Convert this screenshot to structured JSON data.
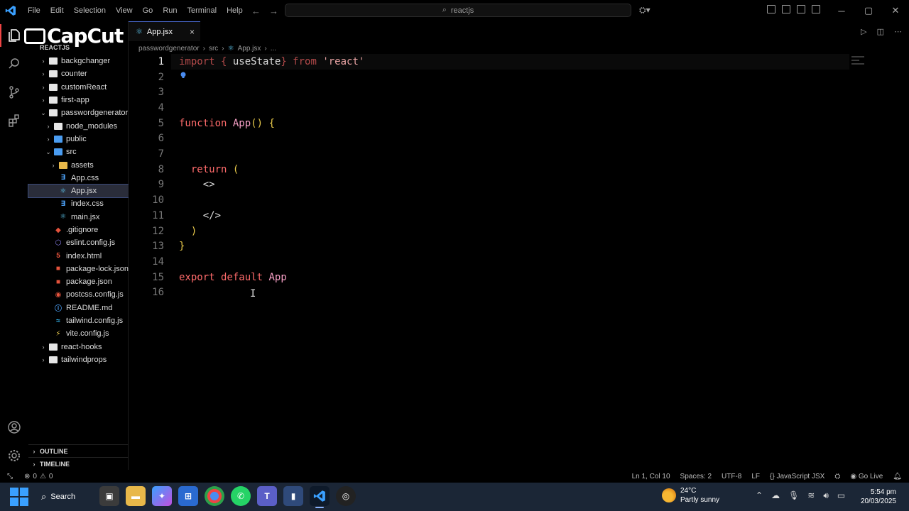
{
  "menu": [
    "File",
    "Edit",
    "Selection",
    "View",
    "Go",
    "Run",
    "Terminal",
    "Help"
  ],
  "command_center": "reactjs",
  "watermark": "CapCut",
  "explorer": {
    "root": "REACTJS",
    "items": [
      {
        "label": "backgchanger",
        "type": "folder",
        "depth": 0,
        "expanded": false
      },
      {
        "label": "counter",
        "type": "folder",
        "depth": 0,
        "expanded": false
      },
      {
        "label": "customReact",
        "type": "folder",
        "depth": 0,
        "expanded": false
      },
      {
        "label": "first-app",
        "type": "folder",
        "depth": 0,
        "expanded": false
      },
      {
        "label": "passwordgenerator",
        "type": "folder",
        "depth": 0,
        "expanded": true
      },
      {
        "label": "node_modules",
        "type": "folder",
        "depth": 1,
        "expanded": false
      },
      {
        "label": "public",
        "type": "folder-blue",
        "depth": 1,
        "expanded": false
      },
      {
        "label": "src",
        "type": "folder-blue",
        "depth": 1,
        "expanded": true
      },
      {
        "label": "assets",
        "type": "folder-yellow",
        "depth": 2,
        "expanded": false
      },
      {
        "label": "App.css",
        "type": "css",
        "depth": 2
      },
      {
        "label": "App.jsx",
        "type": "react",
        "depth": 2,
        "selected": true
      },
      {
        "label": "index.css",
        "type": "css",
        "depth": 2
      },
      {
        "label": "main.jsx",
        "type": "react",
        "depth": 2
      },
      {
        "label": ".gitignore",
        "type": "git",
        "depth": 1
      },
      {
        "label": "eslint.config.js",
        "type": "eslint",
        "depth": 1
      },
      {
        "label": "index.html",
        "type": "html",
        "depth": 1
      },
      {
        "label": "package-lock.json",
        "type": "npm",
        "depth": 1
      },
      {
        "label": "package.json",
        "type": "npm",
        "depth": 1
      },
      {
        "label": "postcss.config.js",
        "type": "postcss",
        "depth": 1
      },
      {
        "label": "README.md",
        "type": "info",
        "depth": 1
      },
      {
        "label": "tailwind.config.js",
        "type": "tailwind",
        "depth": 1
      },
      {
        "label": "vite.config.js",
        "type": "vite",
        "depth": 1
      },
      {
        "label": "react-hooks",
        "type": "folder",
        "depth": 0,
        "expanded": false
      },
      {
        "label": "tailwindprops",
        "type": "folder",
        "depth": 0,
        "expanded": false
      }
    ],
    "outline": "OUTLINE",
    "timeline": "TIMELINE"
  },
  "tab": {
    "label": "App.jsx",
    "close": "×"
  },
  "breadcrumb": [
    "passwordgenerator",
    "src",
    "App.jsx",
    "..."
  ],
  "code": {
    "current_line": 1,
    "lines": [
      [
        {
          "t": "import",
          "c": "kw-dim"
        },
        {
          "t": " { ",
          "c": "kw-dim"
        },
        {
          "t": "useState",
          "c": "pl"
        },
        {
          "t": "} ",
          "c": "kw-dim"
        },
        {
          "t": "from",
          "c": "kw-dim"
        },
        {
          "t": " 'react'",
          "c": "str"
        }
      ],
      [],
      [],
      [],
      [
        {
          "t": "function",
          "c": "kw"
        },
        {
          "t": " ",
          "c": "pl"
        },
        {
          "t": "App",
          "c": "fn"
        },
        {
          "t": "() ",
          "c": "br"
        },
        {
          "t": "{",
          "c": "br"
        }
      ],
      [],
      [],
      [
        {
          "t": "  return",
          "c": "kw"
        },
        {
          "t": " (",
          "c": "br"
        }
      ],
      [
        {
          "t": "    <>",
          "c": "pl"
        }
      ],
      [],
      [
        {
          "t": "    </>",
          "c": "pl"
        }
      ],
      [
        {
          "t": "  )",
          "c": "br"
        }
      ],
      [
        {
          "t": "}",
          "c": "br"
        }
      ],
      [],
      [
        {
          "t": "export",
          "c": "kw"
        },
        {
          "t": " ",
          "c": "pl"
        },
        {
          "t": "default",
          "c": "kw"
        },
        {
          "t": " ",
          "c": "pl"
        },
        {
          "t": "App",
          "c": "fn"
        }
      ],
      []
    ]
  },
  "status": {
    "errors": "0",
    "warnings": "0",
    "position": "Ln 1, Col 10",
    "spaces": "Spaces: 2",
    "encoding": "UTF-8",
    "eol": "LF",
    "language": "JavaScript JSX",
    "golive": "Go Live"
  },
  "taskbar": {
    "search": "Search",
    "weather_temp": "24°C",
    "weather_desc": "Partly sunny",
    "time": "5:54 pm",
    "date": "20/03/2025"
  },
  "colors": {
    "accent": "#e44444",
    "tab_border": "#4a6ad0",
    "taskbar": "#1b2636"
  }
}
